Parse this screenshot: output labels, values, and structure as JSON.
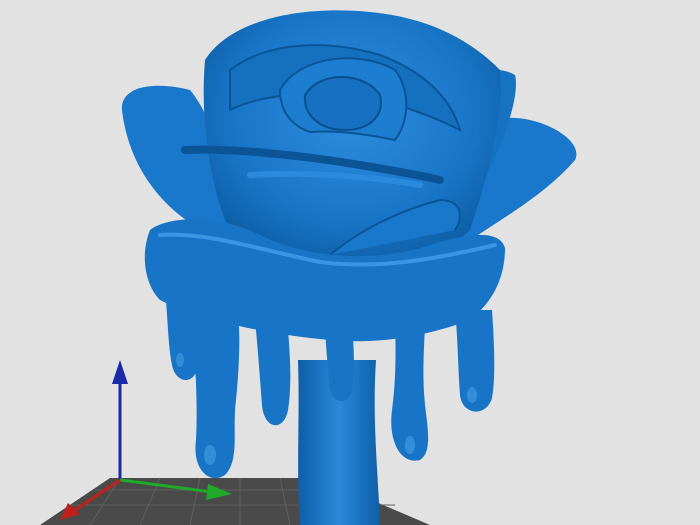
{
  "viewport": {
    "background": "#e2e2e2",
    "model": {
      "icon": "rose-model",
      "color": "#1874c6",
      "shadow_color": "#0b4f8c",
      "highlight_color": "#3f9be6"
    },
    "build_plate": {
      "color": "#4a4a4a",
      "grid_color": "#5e5e5e"
    },
    "axes": {
      "x_axis_color": "#c0201a",
      "y_axis_color": "#1faa2a",
      "z_axis_color": "#1a2aa8"
    }
  }
}
